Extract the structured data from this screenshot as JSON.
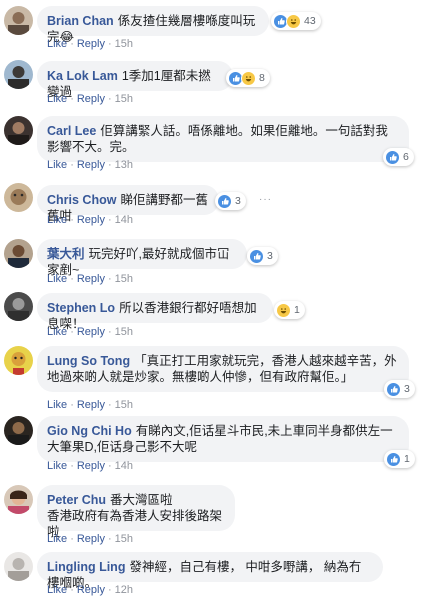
{
  "actions": {
    "like": "Like",
    "reply": "Reply",
    "dot": "·"
  },
  "comments": [
    {
      "author": "Brian Chan",
      "text": "係友揸住幾層樓喺度叫玩完😂",
      "time": "15h",
      "reaction_count": "43"
    },
    {
      "author": "Ka Lok Lam",
      "text": "1季加1厘都未撚變過",
      "time": "15h",
      "reaction_count": "8"
    },
    {
      "author": "Carl Lee",
      "text": "佢算講緊人話。唔係離地。如果佢離地。一句話對我影響不大。完。",
      "time": "13h",
      "reaction_count": "6"
    },
    {
      "author": "Chris Chow",
      "text": "睇佢講野都一舊舊咁",
      "time": "14h",
      "reaction_count": "3"
    },
    {
      "author": "葉大利",
      "text": "玩完好吖,最好就成個市冚家剷~",
      "time": "15h",
      "reaction_count": "3"
    },
    {
      "author": "Stephen Lo",
      "text": "所以香港銀行都好唔想加息㗎！",
      "time": "15h",
      "reaction_count": "1"
    },
    {
      "author": "Lung So Tong",
      "text": "「真正打工用家就玩完，香港人越來越辛苦，外地過來啲人就是炒家。無樓啲人仲慘，但有政府幫佢。」",
      "time": "15h",
      "reaction_count": "3"
    },
    {
      "author": "Gio Ng Chi Ho",
      "text": "有睇內文,佢话星斗市民,未上車同半身都供左一大筆果D,佢话身己影不大呢",
      "time": "14h",
      "reaction_count": "1"
    },
    {
      "author": "Peter Chu",
      "text": "番大灣區啦\n香港政府有為香港人安排後路架啦",
      "time": "15h",
      "reaction_count": ""
    },
    {
      "author": "Lingling Ling",
      "text": "發神經，自己有樓， 中咁多嘢講， 納為冇樓嗰啲。",
      "time": "12h",
      "reaction_count": ""
    }
  ],
  "colors": {
    "author": "#385898",
    "bubble": "#f2f3f5",
    "like_blue": "#4a90e2",
    "haha_yellow": "#f7c846"
  }
}
